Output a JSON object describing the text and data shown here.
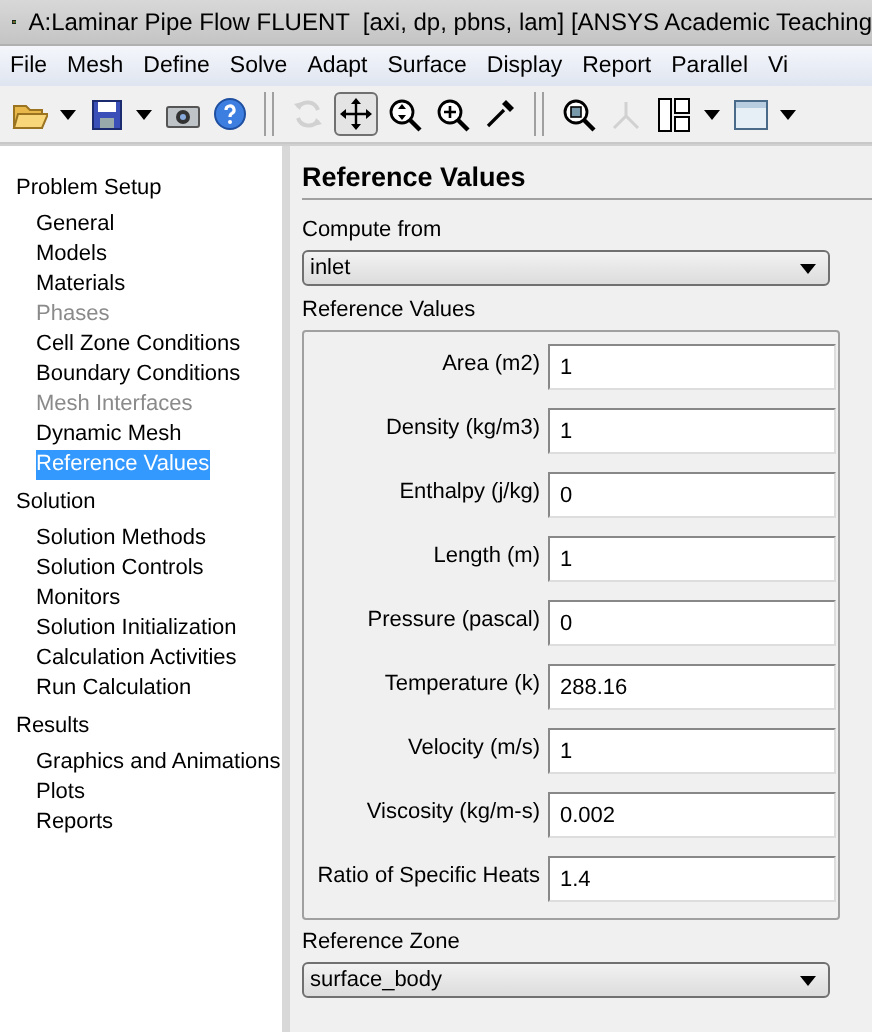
{
  "window": {
    "title": "A:Laminar Pipe Flow FLUENT  [axi, dp, pbns, lam] [ANSYS Academic Teaching"
  },
  "menu": [
    "File",
    "Mesh",
    "Define",
    "Solve",
    "Adapt",
    "Surface",
    "Display",
    "Report",
    "Parallel",
    "Vi"
  ],
  "toolbar": [
    {
      "kind": "open",
      "disabled": false,
      "pressed": false
    },
    {
      "kind": "caret",
      "disabled": false,
      "pressed": false
    },
    {
      "kind": "save",
      "disabled": false,
      "pressed": false
    },
    {
      "kind": "caret",
      "disabled": false,
      "pressed": false
    },
    {
      "kind": "camera",
      "disabled": false,
      "pressed": false
    },
    {
      "kind": "help",
      "disabled": false,
      "pressed": false
    },
    {
      "kind": "sep"
    },
    {
      "kind": "rotate",
      "disabled": true,
      "pressed": false
    },
    {
      "kind": "move",
      "disabled": false,
      "pressed": true
    },
    {
      "kind": "zoomfit",
      "disabled": false,
      "pressed": false
    },
    {
      "kind": "zoomin",
      "disabled": false,
      "pressed": false
    },
    {
      "kind": "probe",
      "disabled": false,
      "pressed": false
    },
    {
      "kind": "sep"
    },
    {
      "kind": "zoommodel",
      "disabled": false,
      "pressed": false
    },
    {
      "kind": "axes",
      "disabled": true,
      "pressed": false
    },
    {
      "kind": "layout",
      "disabled": false,
      "pressed": false
    },
    {
      "kind": "caret",
      "disabled": false,
      "pressed": false
    },
    {
      "kind": "window",
      "disabled": false,
      "pressed": false
    },
    {
      "kind": "caret",
      "disabled": false,
      "pressed": false
    }
  ],
  "navigation": [
    {
      "label": "Problem Setup",
      "children": [
        {
          "label": "General",
          "selected": false,
          "disabled": false
        },
        {
          "label": "Models",
          "selected": false,
          "disabled": false
        },
        {
          "label": "Materials",
          "selected": false,
          "disabled": false
        },
        {
          "label": "Phases",
          "selected": false,
          "disabled": true
        },
        {
          "label": "Cell Zone Conditions",
          "selected": false,
          "disabled": false
        },
        {
          "label": "Boundary Conditions",
          "selected": false,
          "disabled": false
        },
        {
          "label": "Mesh Interfaces",
          "selected": false,
          "disabled": true
        },
        {
          "label": "Dynamic Mesh",
          "selected": false,
          "disabled": false
        },
        {
          "label": "Reference Values",
          "selected": true,
          "disabled": false
        }
      ]
    },
    {
      "label": "Solution",
      "children": [
        {
          "label": "Solution Methods",
          "selected": false,
          "disabled": false
        },
        {
          "label": "Solution Controls",
          "selected": false,
          "disabled": false
        },
        {
          "label": "Monitors",
          "selected": false,
          "disabled": false
        },
        {
          "label": "Solution Initialization",
          "selected": false,
          "disabled": false
        },
        {
          "label": "Calculation Activities",
          "selected": false,
          "disabled": false
        },
        {
          "label": "Run Calculation",
          "selected": false,
          "disabled": false
        }
      ]
    },
    {
      "label": "Results",
      "children": [
        {
          "label": "Graphics and Animations",
          "selected": false,
          "disabled": false
        },
        {
          "label": "Plots",
          "selected": false,
          "disabled": false
        },
        {
          "label": "Reports",
          "selected": false,
          "disabled": false
        }
      ]
    }
  ],
  "panel": {
    "title": "Reference Values",
    "compute_from": {
      "label": "Compute from",
      "value": "inlet"
    },
    "group": {
      "title": "Reference Values",
      "fields": [
        {
          "label": "Area (m2)",
          "value": "1"
        },
        {
          "label": "Density (kg/m3)",
          "value": "1"
        },
        {
          "label": "Enthalpy (j/kg)",
          "value": "0"
        },
        {
          "label": "Length (m)",
          "value": "1"
        },
        {
          "label": "Pressure (pascal)",
          "value": "0"
        },
        {
          "label": "Temperature (k)",
          "value": "288.16"
        },
        {
          "label": "Velocity (m/s)",
          "value": "1"
        },
        {
          "label": "Viscosity (kg/m-s)",
          "value": "0.002"
        },
        {
          "label": "Ratio of Specific Heats",
          "value": "1.4"
        }
      ]
    },
    "reference_zone": {
      "label": "Reference Zone",
      "value": "surface_body"
    }
  }
}
